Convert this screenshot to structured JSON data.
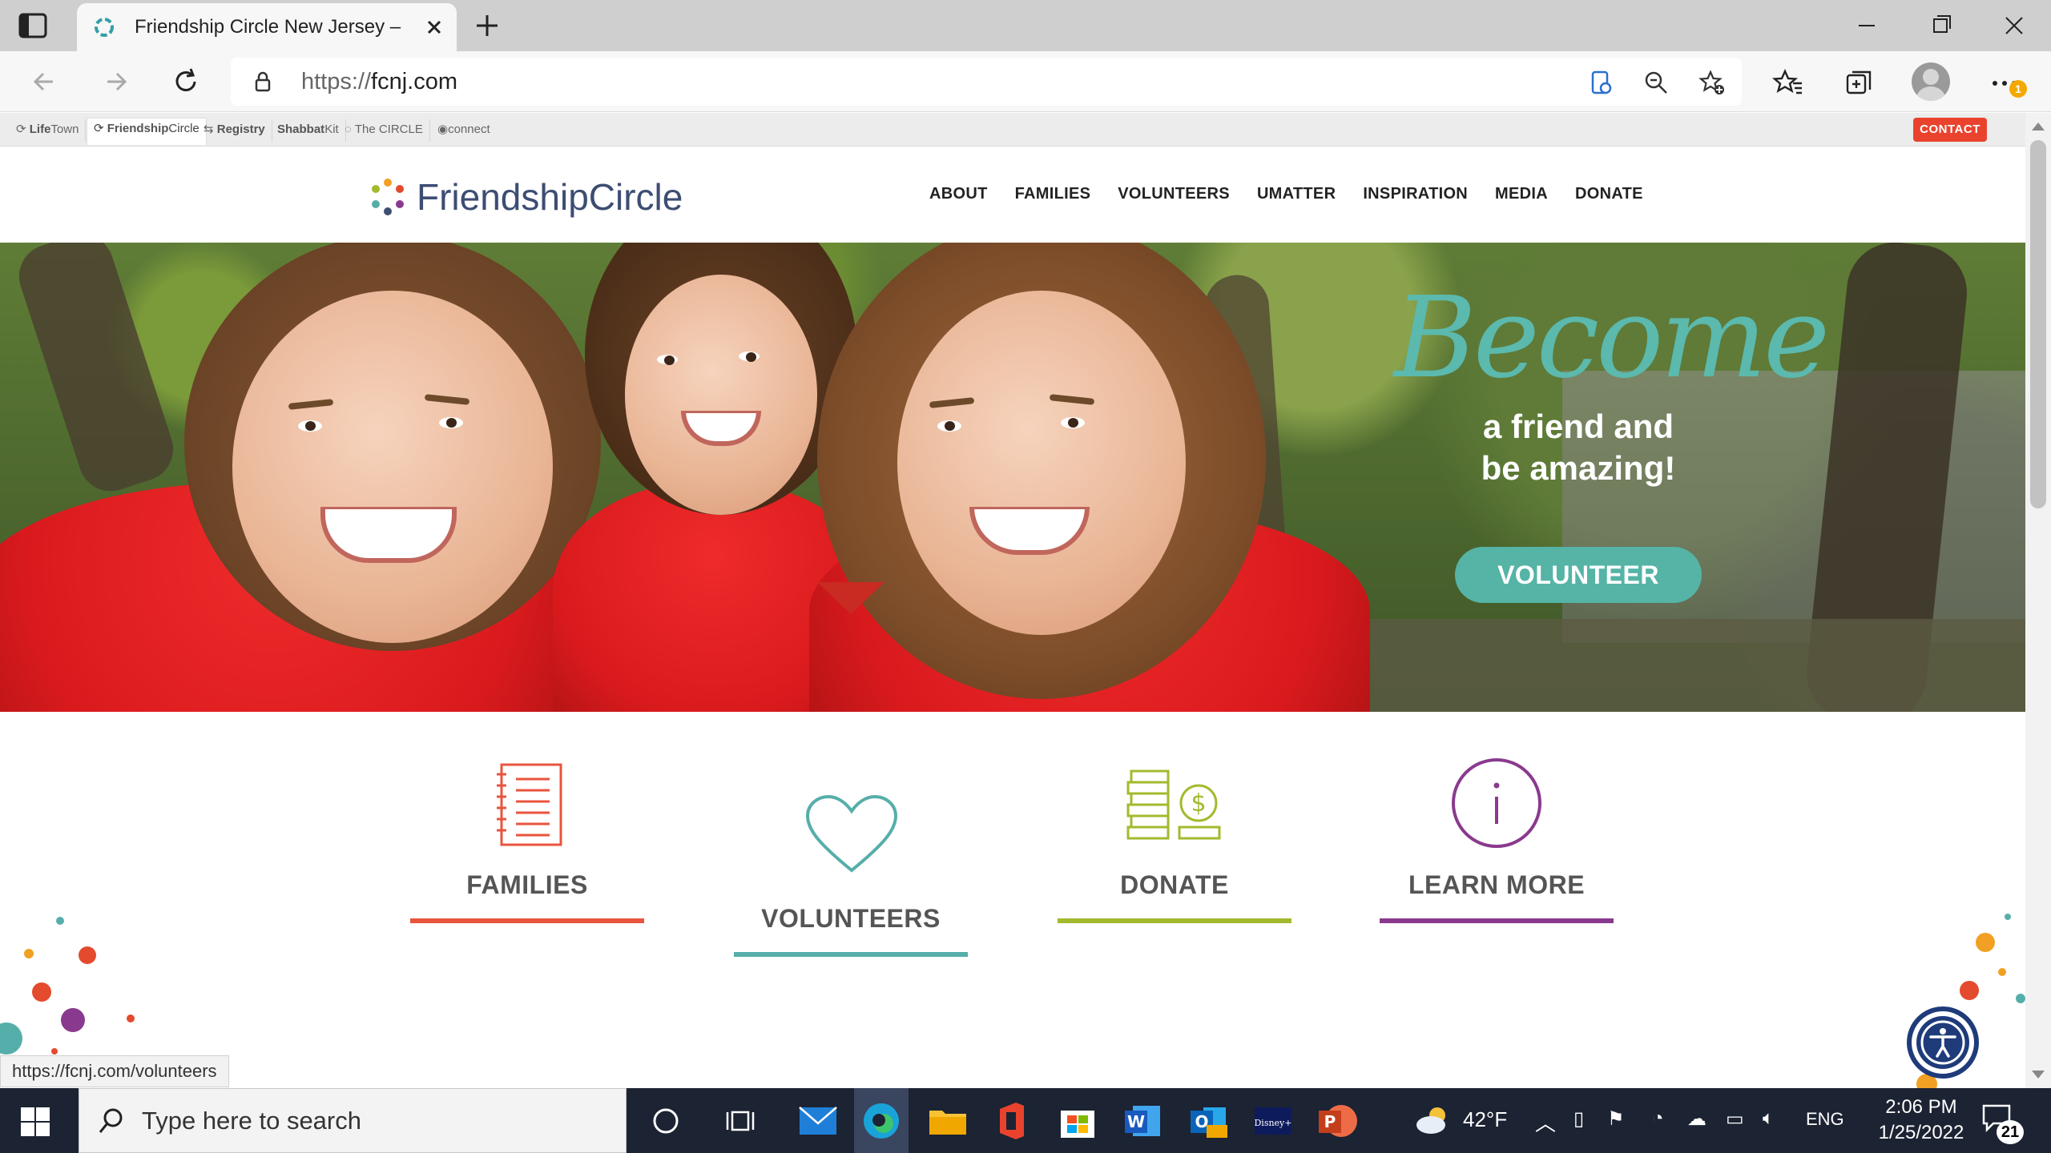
{
  "browser": {
    "tab_title": "Friendship Circle New Jersey – Providing Friendships",
    "url_scheme": "https://",
    "url_host": "fcnj.com",
    "status_url": "https://fcnj.com/volunteers",
    "notification_badge": "1"
  },
  "network": {
    "items": [
      {
        "bold": "Life",
        "rest": "Town"
      },
      {
        "bold": "Friendship",
        "rest": "Circle"
      },
      {
        "bold": "Registry",
        "rest": ""
      },
      {
        "bold": "Shabbat",
        "rest": "Kit"
      },
      {
        "bold": "",
        "rest": "The CIRCLE"
      },
      {
        "bold": "",
        "rest": "connect"
      }
    ],
    "contact_label": "CONTACT"
  },
  "site": {
    "logo_word1": "Friendship",
    "logo_word2": "Circle",
    "nav": [
      "ABOUT",
      "FAMILIES",
      "VOLUNTEERS",
      "UMATTER",
      "INSPIRATION",
      "MEDIA",
      "DONATE"
    ]
  },
  "hero": {
    "headline": "Become",
    "sub_line1": "a friend and",
    "sub_line2": "be amazing!",
    "cta": "VOLUNTEER"
  },
  "cards": [
    {
      "label": "FAMILIES",
      "color": "#e9543e"
    },
    {
      "label": "VOLUNTEERS",
      "color": "#56aeaa"
    },
    {
      "label": "DONATE",
      "color": "#a4b92d"
    },
    {
      "label": "LEARN MORE",
      "color": "#8a3a8e"
    }
  ],
  "taskbar": {
    "search_placeholder": "Type here to search",
    "weather": "42°F",
    "language": "ENG",
    "time": "2:06 PM",
    "date": "1/25/2022",
    "notifications": "21"
  }
}
